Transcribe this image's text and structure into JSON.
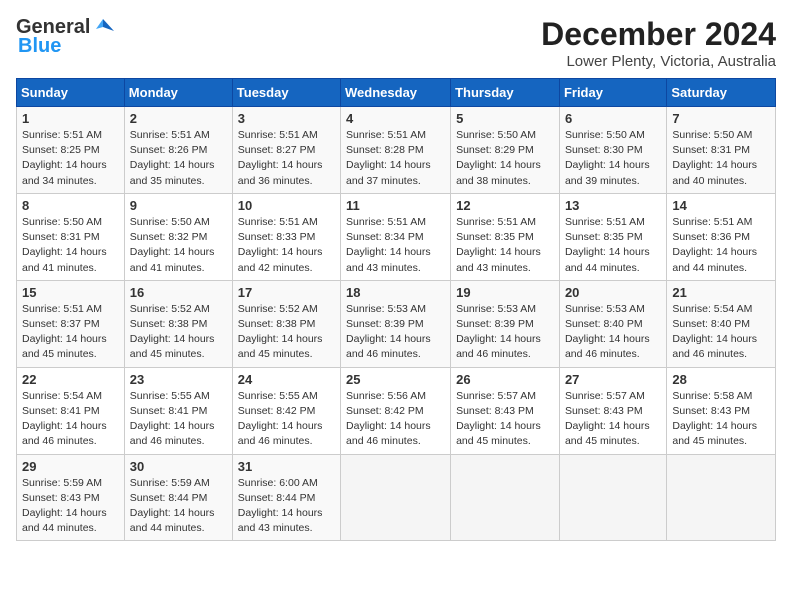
{
  "logo": {
    "line1": "General",
    "line2": "Blue"
  },
  "title": "December 2024",
  "subtitle": "Lower Plenty, Victoria, Australia",
  "days_header": [
    "Sunday",
    "Monday",
    "Tuesday",
    "Wednesday",
    "Thursday",
    "Friday",
    "Saturday"
  ],
  "weeks": [
    [
      {
        "day": "1",
        "sunrise": "5:51 AM",
        "sunset": "8:25 PM",
        "daylight": "14 hours and 34 minutes."
      },
      {
        "day": "2",
        "sunrise": "5:51 AM",
        "sunset": "8:26 PM",
        "daylight": "14 hours and 35 minutes."
      },
      {
        "day": "3",
        "sunrise": "5:51 AM",
        "sunset": "8:27 PM",
        "daylight": "14 hours and 36 minutes."
      },
      {
        "day": "4",
        "sunrise": "5:51 AM",
        "sunset": "8:28 PM",
        "daylight": "14 hours and 37 minutes."
      },
      {
        "day": "5",
        "sunrise": "5:50 AM",
        "sunset": "8:29 PM",
        "daylight": "14 hours and 38 minutes."
      },
      {
        "day": "6",
        "sunrise": "5:50 AM",
        "sunset": "8:30 PM",
        "daylight": "14 hours and 39 minutes."
      },
      {
        "day": "7",
        "sunrise": "5:50 AM",
        "sunset": "8:31 PM",
        "daylight": "14 hours and 40 minutes."
      }
    ],
    [
      {
        "day": "8",
        "sunrise": "5:50 AM",
        "sunset": "8:31 PM",
        "daylight": "14 hours and 41 minutes."
      },
      {
        "day": "9",
        "sunrise": "5:50 AM",
        "sunset": "8:32 PM",
        "daylight": "14 hours and 41 minutes."
      },
      {
        "day": "10",
        "sunrise": "5:51 AM",
        "sunset": "8:33 PM",
        "daylight": "14 hours and 42 minutes."
      },
      {
        "day": "11",
        "sunrise": "5:51 AM",
        "sunset": "8:34 PM",
        "daylight": "14 hours and 43 minutes."
      },
      {
        "day": "12",
        "sunrise": "5:51 AM",
        "sunset": "8:35 PM",
        "daylight": "14 hours and 43 minutes."
      },
      {
        "day": "13",
        "sunrise": "5:51 AM",
        "sunset": "8:35 PM",
        "daylight": "14 hours and 44 minutes."
      },
      {
        "day": "14",
        "sunrise": "5:51 AM",
        "sunset": "8:36 PM",
        "daylight": "14 hours and 44 minutes."
      }
    ],
    [
      {
        "day": "15",
        "sunrise": "5:51 AM",
        "sunset": "8:37 PM",
        "daylight": "14 hours and 45 minutes."
      },
      {
        "day": "16",
        "sunrise": "5:52 AM",
        "sunset": "8:38 PM",
        "daylight": "14 hours and 45 minutes."
      },
      {
        "day": "17",
        "sunrise": "5:52 AM",
        "sunset": "8:38 PM",
        "daylight": "14 hours and 45 minutes."
      },
      {
        "day": "18",
        "sunrise": "5:53 AM",
        "sunset": "8:39 PM",
        "daylight": "14 hours and 46 minutes."
      },
      {
        "day": "19",
        "sunrise": "5:53 AM",
        "sunset": "8:39 PM",
        "daylight": "14 hours and 46 minutes."
      },
      {
        "day": "20",
        "sunrise": "5:53 AM",
        "sunset": "8:40 PM",
        "daylight": "14 hours and 46 minutes."
      },
      {
        "day": "21",
        "sunrise": "5:54 AM",
        "sunset": "8:40 PM",
        "daylight": "14 hours and 46 minutes."
      }
    ],
    [
      {
        "day": "22",
        "sunrise": "5:54 AM",
        "sunset": "8:41 PM",
        "daylight": "14 hours and 46 minutes."
      },
      {
        "day": "23",
        "sunrise": "5:55 AM",
        "sunset": "8:41 PM",
        "daylight": "14 hours and 46 minutes."
      },
      {
        "day": "24",
        "sunrise": "5:55 AM",
        "sunset": "8:42 PM",
        "daylight": "14 hours and 46 minutes."
      },
      {
        "day": "25",
        "sunrise": "5:56 AM",
        "sunset": "8:42 PM",
        "daylight": "14 hours and 46 minutes."
      },
      {
        "day": "26",
        "sunrise": "5:57 AM",
        "sunset": "8:43 PM",
        "daylight": "14 hours and 45 minutes."
      },
      {
        "day": "27",
        "sunrise": "5:57 AM",
        "sunset": "8:43 PM",
        "daylight": "14 hours and 45 minutes."
      },
      {
        "day": "28",
        "sunrise": "5:58 AM",
        "sunset": "8:43 PM",
        "daylight": "14 hours and 45 minutes."
      }
    ],
    [
      {
        "day": "29",
        "sunrise": "5:59 AM",
        "sunset": "8:43 PM",
        "daylight": "14 hours and 44 minutes."
      },
      {
        "day": "30",
        "sunrise": "5:59 AM",
        "sunset": "8:44 PM",
        "daylight": "14 hours and 44 minutes."
      },
      {
        "day": "31",
        "sunrise": "6:00 AM",
        "sunset": "8:44 PM",
        "daylight": "14 hours and 43 minutes."
      },
      null,
      null,
      null,
      null
    ]
  ]
}
